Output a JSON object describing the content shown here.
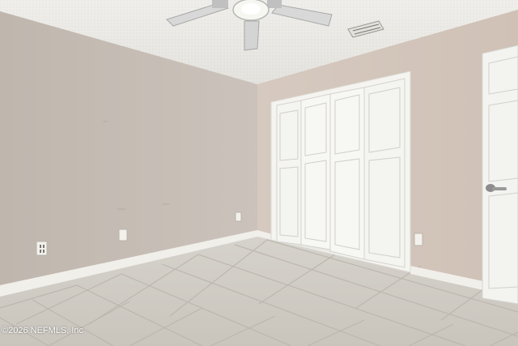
{
  "watermark": {
    "text": "©2026 NEFMLS, Inc"
  },
  "colors": {
    "ceiling": "#ecebe7",
    "left_wall": "#c7bfb7",
    "right_wall": "#d3c6bc",
    "baseboard": "#f3f1ec",
    "floor_tile": "#cfcbc3",
    "grout": "#b4afa6",
    "door": "#f4f4f1",
    "door_shadow": "#d8d8d2"
  }
}
